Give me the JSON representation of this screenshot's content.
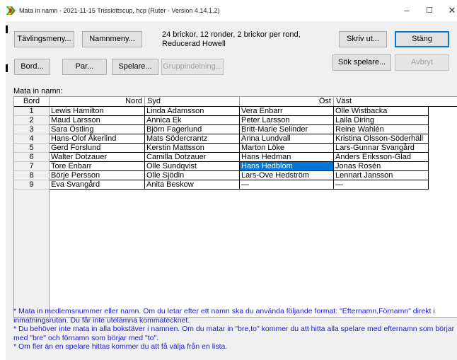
{
  "window": {
    "title": "Mata in namn - 2021-11-15  Trisslottscup, hcp  (Ruter - Version 4.14.1.2)",
    "minimize": "–",
    "maximize": "☐",
    "close": "✕"
  },
  "toolbar": {
    "tavlingsmeny": "Tävlingsmeny...",
    "namnmeny": "Namnmeny...",
    "bord": "Bord...",
    "par": "Par...",
    "spelare": "Spelare...",
    "gruppindelning": "Gruppindelning...",
    "skriv_ut": "Skriv ut...",
    "stang": "Stäng",
    "sok_spelare": "Sök spelare...",
    "avbryt": "Avbryt"
  },
  "info": {
    "line1": "24 brickor, 12 ronder, 2 brickor per rond,",
    "line2": "Reducerad Howell"
  },
  "mata_label": "Mata in namn:",
  "table": {
    "headers": {
      "bord": "Bord",
      "nord": "Nord",
      "syd": "Syd",
      "ost": "Öst",
      "vast": "Väst"
    },
    "rows": [
      {
        "bord": "1",
        "nord": "Lewis Hamilton",
        "syd": "Linda Adamsson",
        "ost": "Vera Enbarr",
        "vast": "Olle Wistbacka"
      },
      {
        "bord": "2",
        "nord": "Maud Larsson",
        "syd": "Annica Ek",
        "ost": "Peter Larsson",
        "vast": "Laila Diring"
      },
      {
        "bord": "3",
        "nord": "Sara Östling",
        "syd": "Björn Fagerlund",
        "ost": "Britt-Marie Selinder",
        "vast": "Reine Wahlén"
      },
      {
        "bord": "4",
        "nord": "Hans-Olof Åkerlind",
        "syd": "Mats Södercrantz",
        "ost": "Anna Lundvall",
        "vast": "Kristina Olsson-Söderhäll"
      },
      {
        "bord": "5",
        "nord": "Gerd Forslund",
        "syd": "Kerstin Mattsson",
        "ost": "Marton Löke",
        "vast": "Lars-Gunnar Svangård"
      },
      {
        "bord": "6",
        "nord": "Walter Dotzauer",
        "syd": "Camilla Dotzauer",
        "ost": "Hans Hedman",
        "vast": "Anders Eriksson-Glad"
      },
      {
        "bord": "7",
        "nord": "Tore Enbarr",
        "syd": "Olle Sundqvist",
        "ost": "Hans Hedblom",
        "vast": "Jonas Rosén"
      },
      {
        "bord": "8",
        "nord": "Börje Persson",
        "syd": "Olle Sjödin",
        "ost": "Lars-Ove Hedström",
        "vast": "Lennart Jansson"
      },
      {
        "bord": "9",
        "nord": "Eva Svangård",
        "syd": "Anita Beskow",
        "ost": "—",
        "vast": "—"
      }
    ],
    "selected": {
      "row": 6,
      "column": "ost"
    }
  },
  "help": {
    "line1": "* Mata in medlemsnummer eller namn. Om du letar efter ett namn ska du använda följande format: \"Efternamn,Förnamn\" direkt i inmatningsrutan. Du får inte utelämna kommatecknet.",
    "line2": "* Du behöver inte mata in alla bokstäver i namnen. Om du matar in \"bre,to\" kommer du att hitta alla spelare med efternamn som börjar med \"bre\" och förnamn som börjar med \"to\".",
    "line3": "* Om fler än en spelare hittas kommer du att få välja från en lista."
  },
  "colors": {
    "selection": "#0078d7",
    "help_text": "#1a1adb",
    "focus_border": "#0078d7"
  }
}
